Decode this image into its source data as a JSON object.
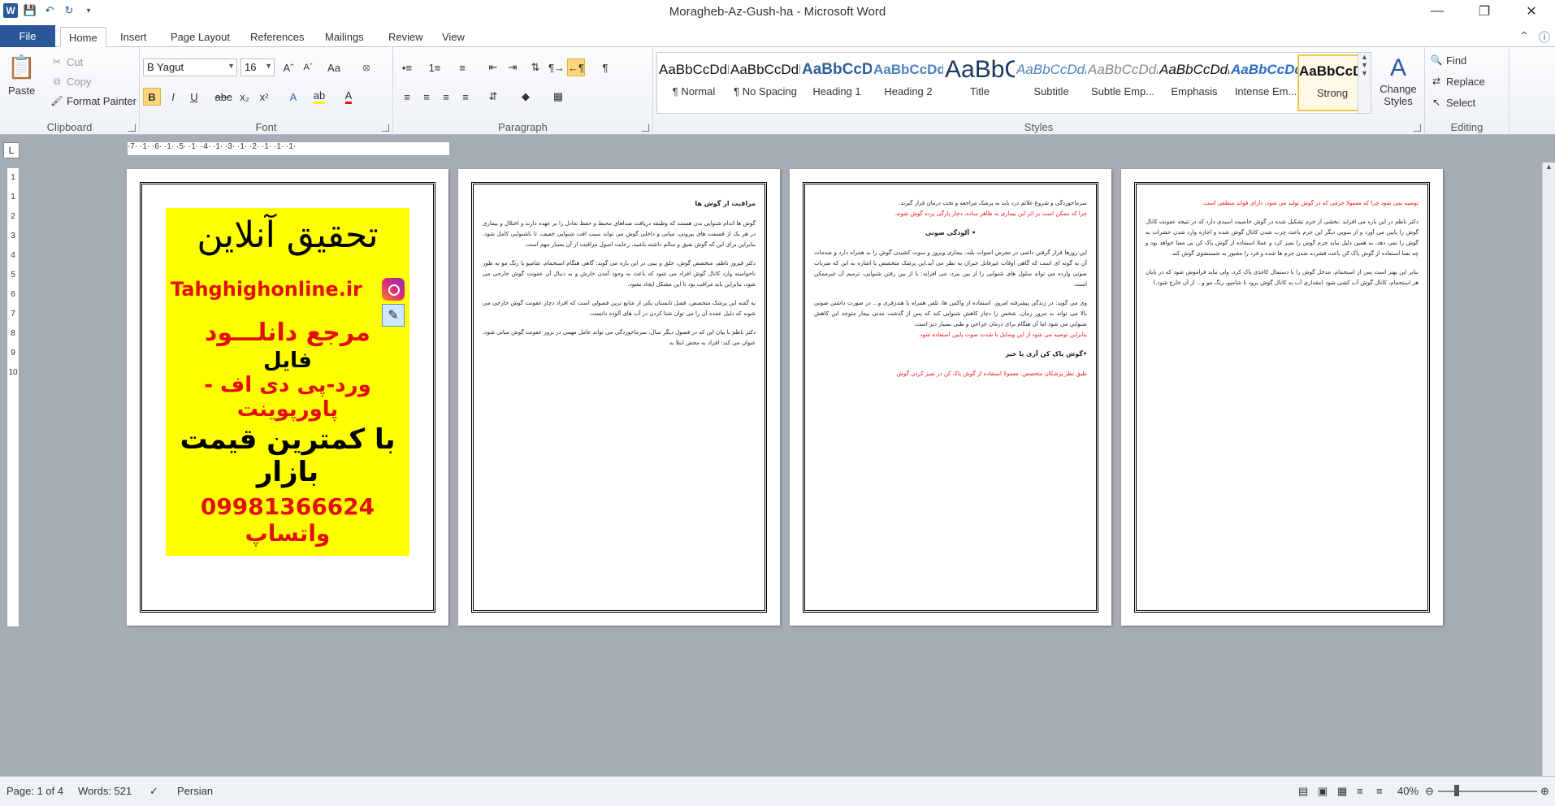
{
  "window": {
    "title": "Moragheb-Az-Gush-ha  -  Microsoft Word"
  },
  "tabs": [
    "File",
    "Home",
    "Insert",
    "Page Layout",
    "References",
    "Mailings",
    "Review",
    "View"
  ],
  "clipboard": {
    "paste": "Paste",
    "cut": "Cut",
    "copy": "Copy",
    "format_painter": "Format Painter",
    "label": "Clipboard"
  },
  "font": {
    "name": "B Yagut",
    "size": "16",
    "label": "Font"
  },
  "paragraph": {
    "label": "Paragraph"
  },
  "styles": {
    "label": "Styles",
    "items": [
      {
        "preview": "AaBbCcDdEe",
        "name": "¶ Normal"
      },
      {
        "preview": "AaBbCcDdEe",
        "name": "¶ No Spacing"
      },
      {
        "preview": "AaBbCcDdEe",
        "name": "Heading 1"
      },
      {
        "preview": "AaBbCcDdEe",
        "name": "Heading 2"
      },
      {
        "preview": "AaBbCcDdEe",
        "name": "Title"
      },
      {
        "preview": "AaBbCcDdEe",
        "name": "Subtitle"
      },
      {
        "preview": "AaBbCcDdEe",
        "name": "Subtle Emp..."
      },
      {
        "preview": "AaBbCcDdEe",
        "name": "Emphasis"
      },
      {
        "preview": "AaBbCcDdEe",
        "name": "Intense Em..."
      },
      {
        "preview": "AaBbCcDdEe",
        "name": "Strong"
      }
    ],
    "change_styles": "Change Styles"
  },
  "editing": {
    "find": "Find",
    "replace": "Replace",
    "select": "Select",
    "label": "Editing"
  },
  "ruler": {
    "h_ticks": "·7· ·1· ·6· ·1· ·5· ·1· ·4· ·1· ·3· ·1· ·2· ·1· ·1· ·1·",
    "v_ticks": [
      "1",
      "1",
      "2",
      "3",
      "4",
      "5",
      "6",
      "7",
      "8",
      "9",
      "10"
    ]
  },
  "pages": {
    "p1": {
      "l1": "تحقیق آنلاین",
      "l2": "Tahghighonline.ir",
      "l3": "مرجع دانلـــود",
      "l4": "فایل",
      "l5": "ورد-پی دی اف - پاورپوینت",
      "l6": "با کمترین قیمت بازار",
      "l7": "09981366624 واتساپ"
    },
    "p2": {
      "heading": "مراقبت از گوش ها",
      "para1": "گوش ها اندام شنوایی بدن هستند که وظیفه دریافت صداهای محیط و حفظ تعادل را بر عهده دارند و اختلال و بیماری در هر یک از قسمت های بیرونی، میانی و داخلی گوش می تواند سبب افت شنوایی خفیف، تا ناشنوایی کامل شود، بنابراین برای این که گوش نفیق و سالم داشته باشید، رعایت اصول مراقبت از آن بسیار مهم است.",
      "para2": "دکتر فیروز ناظم، متخصص گوش، حلق و بینی در این باره می گوید: گاهی هنگام استحمام، شامپو یا رنگ مو به طور ناخواسته وارد کانال گوش افراد می شود که باعث به وجود آمدن خارش و به دنبال آن عفونت گوش خارجی می شود، بنابراین باید مراقب بود تا این مشکل ایجاد نشود.",
      "para3": "به گفته این پزشک متخصص، فصل تابستان یکی از شایع ترین فصولی است که افراد دچار عفونت گوش خارجی می شوند که دلیل عمده آن را می توان شنا کردن در آب های آلوده دانست.",
      "para4": "دکتر ناظم با بیان این که در فصول دیگر سال، سرماخوردگی می تواند عامل مهمی در بروز عفونت گوش میانی شود، عنوان می کند: افراد به محض ابتلا به"
    },
    "p3": {
      "para1": "سرماخوردگی و شروع علائم درد باید به پزشک مراجعه و تحت درمان قرار گیرند.",
      "para1_red": "چرا که ممکن است بر اثر این بیماری به ظاهر ساده، دچار پارگی پرده گوش شوند.",
      "bullet1": "• آلودگی صوتی",
      "para2": "این روزها قرار گرفتن دائمی در معرض اصوات بلند، بیماری ویروز و سوت کشیدن گوش را به همراه دارد و صدمات آن به گونه ای است که گاهی اوقات غیرقابل جبران به نظر می آید.این پزشک متخصص با اشاره به این که ضربات صوتی وارده می تواند سلول های شنوایی را از بین ببرد، می افزاید: با از بین رفتن شنوایی، ترمیم آن غیرممکن است.",
      "para3": "وی می گوید: در زندگی پیشرفته امروز، استفاده از واکمن ها، تلفن همراه یا هندزفری و... در صورت داشتن صوتی بالا می تواند به مرور زمان، شخص را دچار کاهش شنوایی کند که پس از گذشت مدتی بیمار متوجه این کاهش شنوایی می شود اما آن هنگام برای درمان جراحی و طبی بسیار دیر است.",
      "para3_red": "بنابراین توصیه می شود از این وسایل با شدت صوت پایین استفاده شود.",
      "bullet2": "•گوش پاک کن آری یا خیر",
      "para4_red": "طبق نظر پزشکان متخصص، معمولا استفاده از گوش پاک کن در تمیز کردن گوش"
    },
    "p4": {
      "para1_red": "توصیه نمی شود چرا که معمولا جرمی که در گوش تولید می شود، دارای فواید منطقی است.",
      "para2": "دکتر ناظم در این باره می افزاید :بخشی از جرم تشکیل شده در گوش خاصیت اسیدی دارد که در نتیجه عفونت کانال گوش را پایین می آورد و از سویی دیگر این جرم باعث چرب شدن کانال گوش شده و اجازه وارد شدن حشرات به گوش را نمی دهد، به همین دلیل نباید جرم گوش را تمیز کرد و عملا استفاده از گوش پاک کن بی معنا خواهد بود و چه بسا استفاده از گوش پاک کن باعث فشرده شدن جرم ها شده و فرد را مجبور به شستشوی گوش کند.",
      "para3": "بنابر این بهتر است پس از استحمام، مدخل گوش را با دستمال کاغذی پاک کرد، ولی نباید فراموش شود که در پایان هر استحمام، کانال گوش آب کشی شود (مقداری آب به کانال گوش برود تا شامپو، رنگ مو و... از آن خارج شود.)"
    }
  },
  "status": {
    "page": "Page: 1 of 4",
    "words": "Words: 521",
    "language": "Persian",
    "zoom": "40%"
  }
}
